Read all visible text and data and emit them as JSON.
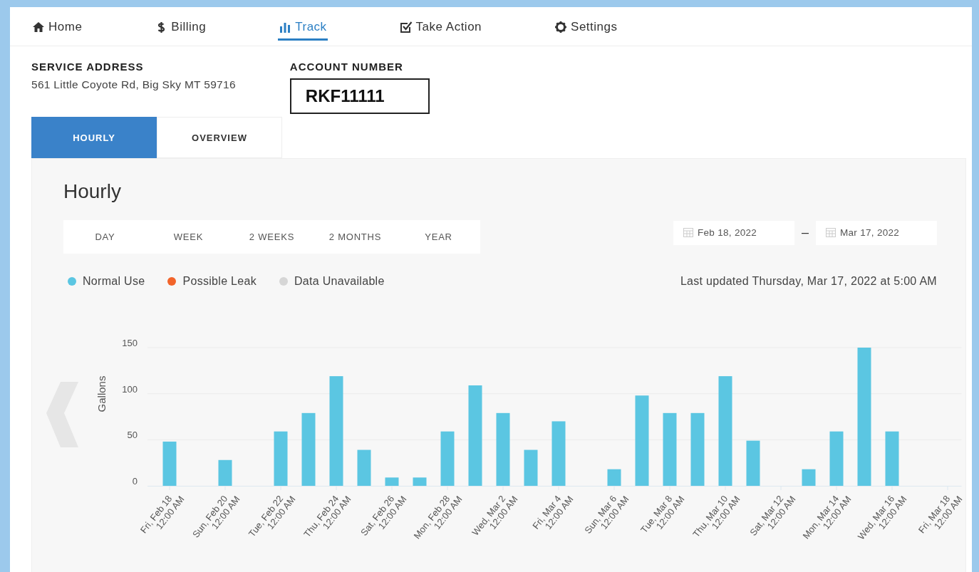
{
  "nav": [
    {
      "label": "Home",
      "selected": false
    },
    {
      "label": "Billing",
      "selected": false
    },
    {
      "label": "Track",
      "selected": true
    },
    {
      "label": "Take Action",
      "selected": false
    },
    {
      "label": "Settings",
      "selected": false
    }
  ],
  "service_address": {
    "label": "SERVICE ADDRESS",
    "value": "561 Little Coyote Rd, Big Sky MT 59716"
  },
  "account_number": {
    "label": "ACCOUNT NUMBER",
    "value": "RKF11111"
  },
  "view_tabs": [
    {
      "label": "HOURLY",
      "selected": true
    },
    {
      "label": "OVERVIEW",
      "selected": false
    }
  ],
  "panel": {
    "title": "Hourly",
    "ranges": [
      {
        "label": "DAY",
        "selected": false
      },
      {
        "label": "WEEK",
        "selected": false
      },
      {
        "label": "2 WEEKS",
        "selected": false
      },
      {
        "label": "2 MONTHS",
        "selected": false
      },
      {
        "label": "YEAR",
        "selected": false
      }
    ],
    "date_from": "Feb 18, 2022",
    "date_separator": "–",
    "date_to": "Mar 17, 2022",
    "legend": [
      {
        "label": "Normal Use",
        "color": "#5bc6e2"
      },
      {
        "label": "Possible Leak",
        "color": "#f2642a"
      },
      {
        "label": "Data Unavailable",
        "color": "#d6d6d6"
      }
    ],
    "last_updated": "Last updated Thursday, Mar 17, 2022 at 5:00 AM",
    "chart_data": {
      "type": "bar",
      "ylabel": "Gallons",
      "categories": [
        "Fri, Feb 18\n12:00 AM",
        null,
        "Sun, Feb 20\n12:00 AM",
        null,
        "Tue, Feb 22\n12:00 AM",
        null,
        "Thu, Feb 24\n12:00 AM",
        null,
        "Sat, Feb 26\n12:00 AM",
        null,
        "Mon, Feb 28\n12:00 AM",
        null,
        "Wed, Mar 2\n12:00 AM",
        null,
        "Fri, Mar 4\n12:00 AM",
        null,
        "Sun, Mar 6\n12:00 AM",
        null,
        "Tue, Mar 8\n12:00 AM",
        null,
        "Thu, Mar 10\n12:00 AM",
        null,
        "Sat, Mar 12\n12:00 AM",
        null,
        "Mon, Mar 14\n12:00 AM",
        null,
        "Wed, Mar 16\n12:00 AM",
        null,
        "Fri, Mar 18\n12:00 AM"
      ],
      "series": [
        {
          "color": "#5bc6e2",
          "values": [
            48,
            null,
            28,
            null,
            59,
            79,
            119,
            39,
            9,
            9,
            59,
            109,
            79,
            39,
            70,
            null,
            18,
            98,
            79,
            79,
            119,
            49,
            null,
            18,
            59,
            150,
            59,
            null,
            null
          ]
        }
      ],
      "ylim": [
        0,
        150
      ],
      "yticks": [
        0,
        50,
        100,
        150
      ]
    }
  }
}
